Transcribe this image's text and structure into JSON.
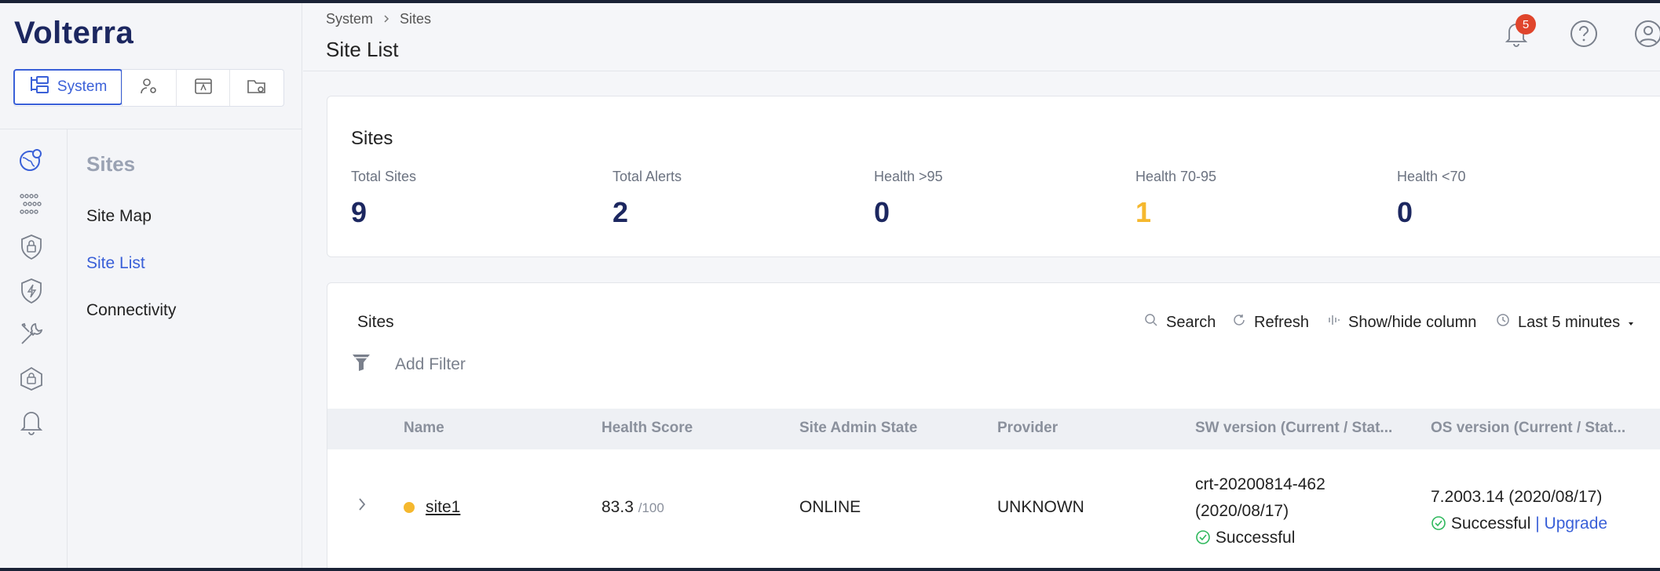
{
  "app": {
    "brand": "Volterra"
  },
  "workspace_switcher": {
    "active_label": "System"
  },
  "sidebar": {
    "section_title": "Sites",
    "items": [
      {
        "label": "Site Map",
        "active": false
      },
      {
        "label": "Site List",
        "active": true
      },
      {
        "label": "Connectivity",
        "active": false
      }
    ]
  },
  "header": {
    "breadcrumb": [
      "System",
      "Sites"
    ],
    "title": "Site List",
    "notification_count": "5"
  },
  "summary": {
    "title": "Sites",
    "stats": [
      {
        "label": "Total Sites",
        "value": "9"
      },
      {
        "label": "Total Alerts",
        "value": "2"
      },
      {
        "label": "Health >95",
        "value": "0"
      },
      {
        "label": "Health 70-95",
        "value": "1"
      },
      {
        "label": "Health <70",
        "value": "0"
      }
    ]
  },
  "table": {
    "title": "Sites",
    "toolbar": {
      "search": "Search",
      "refresh": "Refresh",
      "columns": "Show/hide column",
      "time_range": "Last 5 minutes"
    },
    "filter_placeholder": "Add Filter",
    "columns": [
      "Name",
      "Health Score",
      "Site Admin State",
      "Provider",
      "SW version (Current / Stat...",
      "OS version (Current / Stat..."
    ],
    "rows": [
      {
        "name": "site1",
        "health": "83.3",
        "health_max": "/100",
        "admin_state": "ONLINE",
        "provider": "UNKNOWN",
        "sw_version": "crt-20200814-462",
        "sw_date": "(2020/08/17)",
        "sw_status": "Successful",
        "os_version": "7.2003.14 (2020/08/17)",
        "os_status": "Successful",
        "os_action": "Upgrade"
      }
    ]
  },
  "colors": {
    "accent": "#3a60d8",
    "brand": "#1c2760",
    "warn": "#f5b82e",
    "success": "#2eb85c",
    "badge": "#e0452c"
  }
}
